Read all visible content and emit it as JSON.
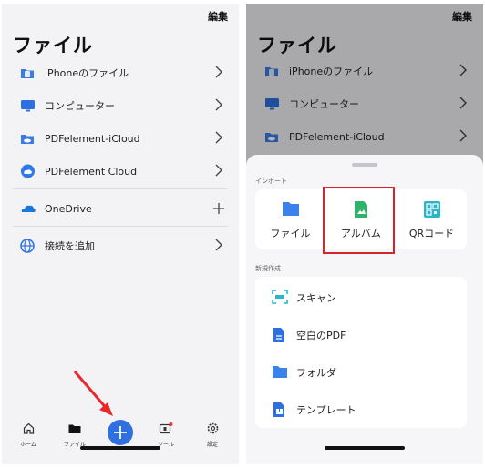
{
  "left": {
    "edit_label": "編集",
    "title": "ファイル",
    "items": [
      {
        "label": "iPhoneのファイル",
        "icon": "folder-phone-icon"
      },
      {
        "label": "コンピューター",
        "icon": "monitor-icon"
      },
      {
        "label": "PDFelement-iCloud",
        "icon": "cloud-folder-icon"
      },
      {
        "label": "PDFelement Cloud",
        "icon": "cloud-icon"
      },
      {
        "label": "OneDrive",
        "icon": "onedrive-icon"
      },
      {
        "label": "接続を追加",
        "icon": "globe-icon"
      }
    ],
    "tabs": [
      {
        "label": "ホーム",
        "icon": "home-icon"
      },
      {
        "label": "ファイル",
        "icon": "folder-icon"
      },
      {
        "label": "ツール",
        "icon": "toolbox-icon"
      },
      {
        "label": "設定",
        "icon": "gear-icon"
      }
    ]
  },
  "right": {
    "edit_label": "編集",
    "title": "ファイル",
    "items": [
      {
        "label": "iPhoneのファイル"
      },
      {
        "label": "コンピューター"
      },
      {
        "label": "PDFelement-iCloud"
      }
    ],
    "sheet": {
      "import_heading": "インポート",
      "import_tiles": [
        {
          "label": "ファイル",
          "icon": "folder-icon"
        },
        {
          "label": "アルバム",
          "icon": "image-file-icon"
        },
        {
          "label": "QRコード",
          "icon": "qr-code-icon"
        }
      ],
      "create_heading": "新規作成",
      "create_items": [
        {
          "label": "スキャン",
          "icon": "scan-icon"
        },
        {
          "label": "空白のPDF",
          "icon": "pdf-file-icon"
        },
        {
          "label": "フォルダ",
          "icon": "folder-icon"
        },
        {
          "label": "テンプレート",
          "icon": "template-icon"
        }
      ]
    }
  },
  "colors": {
    "accent": "#2f6fe0",
    "highlight": "#d6242c",
    "green": "#2fb36b",
    "teal": "#2bb5c7"
  }
}
